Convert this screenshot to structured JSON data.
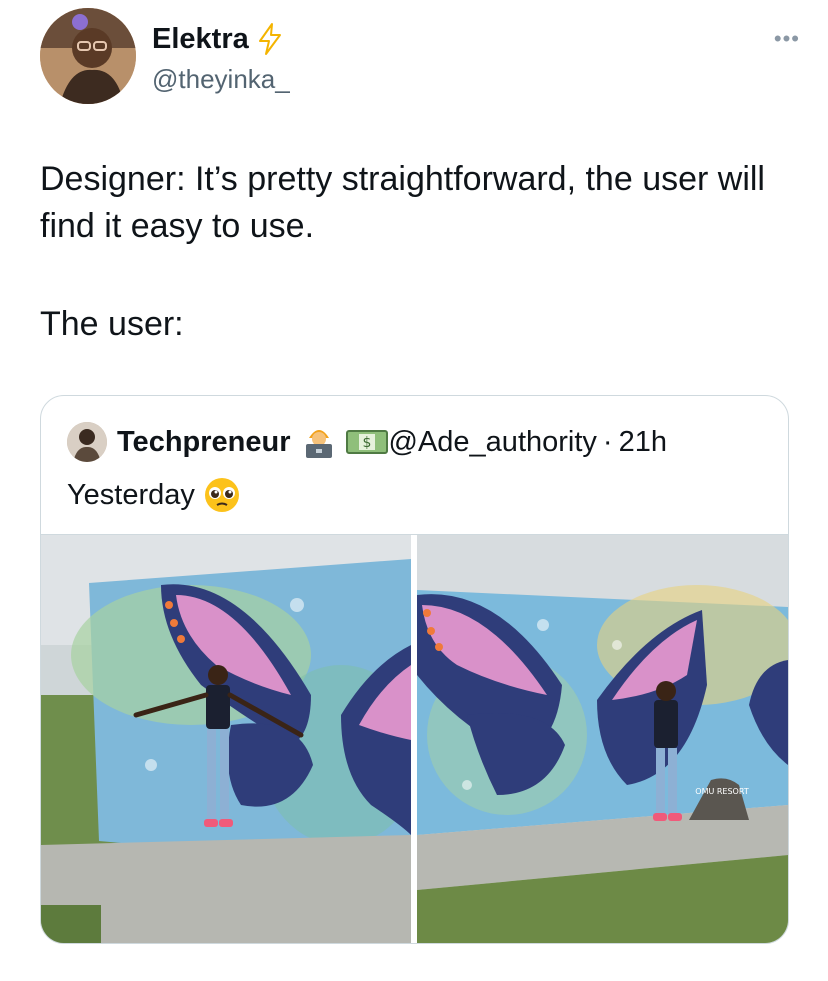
{
  "author": {
    "name": "Elektra",
    "handle": "@theyinka_",
    "badge_icon": "lightning-bolt-icon"
  },
  "tweet": {
    "lines": [
      "Designer: It’s pretty straightforward, the user will find it easy to use.",
      "The user:"
    ]
  },
  "quoted_tweet": {
    "author_name": "Techpreneur",
    "emojis": [
      "technologist-emoji",
      "dollar-banknote-emoji"
    ],
    "handle": "@Ade_authority",
    "separator": "·",
    "time": "21h",
    "text": "Yesterday",
    "text_emoji": "pleading-face-emoji",
    "photos": [
      {
        "name": "photo-butterfly-wall-left"
      },
      {
        "name": "photo-butterfly-wall-right",
        "sign_text": "OMU RESORT"
      }
    ]
  },
  "colors": {
    "text": "#0f1419",
    "secondary": "#536471",
    "border": "#cfd9de",
    "bolt": "#f4b400"
  }
}
